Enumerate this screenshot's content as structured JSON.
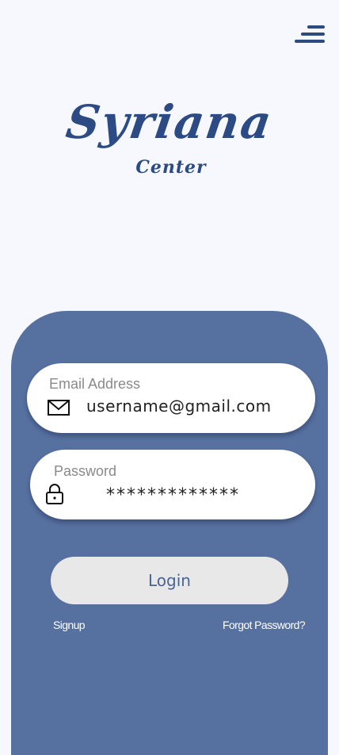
{
  "app": {
    "logo_title": "Syriana",
    "logo_subtitle": "Center"
  },
  "header": {
    "menu_icon": "hamburger-menu-icon"
  },
  "form": {
    "email": {
      "label": "Email Address",
      "value": "username@gmail.com",
      "icon": "envelope-icon"
    },
    "password": {
      "label": "Password",
      "value": "*************",
      "icon": "lock-icon"
    },
    "login_label": "Login",
    "signup_label": "Signup",
    "forgot_label": "Forgot Password?"
  },
  "colors": {
    "background": "#f6f8fd",
    "brand": "#2c4a84",
    "panel": "#5670a0",
    "button": "#e8e8e8"
  }
}
